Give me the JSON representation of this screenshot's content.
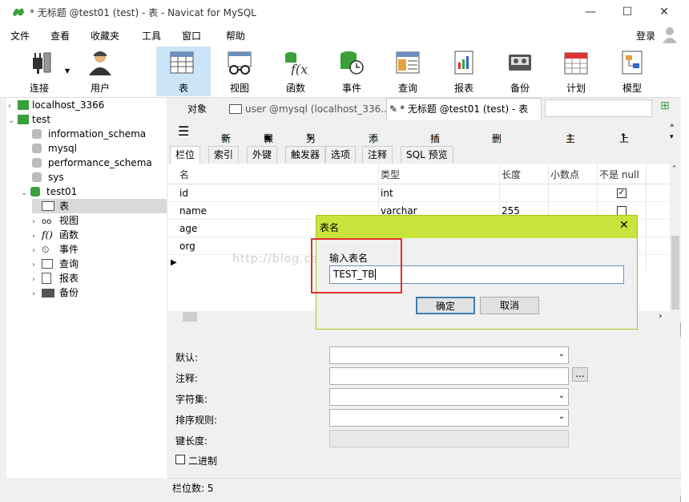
{
  "window": {
    "title": "* 无标题 @test01 (test) - 表 - Navicat for MySQL"
  },
  "menu": [
    "文件",
    "查看",
    "收藏夹",
    "工具",
    "窗口",
    "帮助"
  ],
  "login": "登录",
  "toolbar": [
    {
      "label": "连接",
      "icon": "plug-icon"
    },
    {
      "label": "用户",
      "icon": "user-icon"
    },
    {
      "label": "表",
      "icon": "table-icon"
    },
    {
      "label": "视图",
      "icon": "view-icon"
    },
    {
      "label": "函数",
      "icon": "function-icon"
    },
    {
      "label": "事件",
      "icon": "event-icon"
    },
    {
      "label": "查询",
      "icon": "query-icon"
    },
    {
      "label": "报表",
      "icon": "report-icon"
    },
    {
      "label": "备份",
      "icon": "backup-icon"
    },
    {
      "label": "计划",
      "icon": "schedule-icon"
    },
    {
      "label": "模型",
      "icon": "model-icon"
    }
  ],
  "tree": {
    "conn1": "localhost_3366",
    "conn2": "test",
    "dbs": [
      "information_schema",
      "mysql",
      "performance_schema",
      "sys",
      "test01"
    ],
    "nodes": [
      "表",
      "视图",
      "函数",
      "事件",
      "查询",
      "报表",
      "备份"
    ]
  },
  "tabs": {
    "objects": "对象",
    "user": "user @mysql (localhost_336...",
    "current": "* 无标题 @test01 (test) - 表"
  },
  "edit_toolbar": {
    "new": "新建",
    "save": "保存",
    "saveas": "另存为",
    "add_field": "添加栏位",
    "insert_field": "插入栏位",
    "delete_field": "删除栏位",
    "primary_key": "主键",
    "move_up": "上移"
  },
  "sub_tabs": [
    "栏位",
    "索引",
    "外键",
    "触发器",
    "选项",
    "注释",
    "SQL 预览"
  ],
  "grid": {
    "headers": [
      "名",
      "类型",
      "长度",
      "小数点",
      "不是 null"
    ],
    "rows": [
      {
        "name": "id",
        "type": "int",
        "length": "",
        "notnull": true
      },
      {
        "name": "name",
        "type": "varchar",
        "length": "255",
        "notnull": false
      },
      {
        "name": "age",
        "type": "",
        "length": "",
        "notnull": false
      },
      {
        "name": "org",
        "type": "",
        "length": "",
        "notnull": false
      }
    ]
  },
  "props": {
    "default": "默认:",
    "comment": "注释:",
    "charset": "字符集:",
    "collation": "排序规则:",
    "keylen": "键长度:",
    "binary": "二进制",
    "more": "..."
  },
  "status": "栏位数: 5",
  "dialog": {
    "title": "表名",
    "prompt": "输入表名",
    "value": "TEST_TB",
    "ok": "确定",
    "cancel": "取消"
  },
  "watermark": "http://blog.csdn.net/yerongtao",
  "colors": {
    "accent": "#c8e43c",
    "highlight_box": "#e03030",
    "selected_tab": "#cce4f7"
  }
}
